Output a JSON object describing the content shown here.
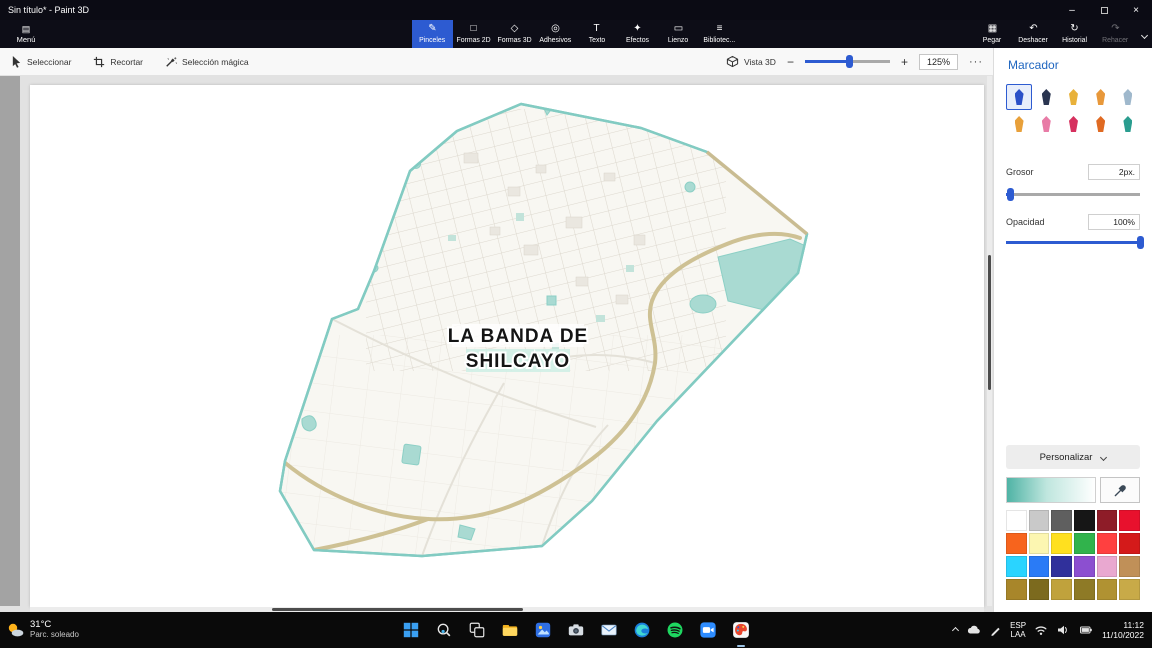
{
  "title_bar": {
    "title": "Sin título* - Paint 3D"
  },
  "icons": {
    "menu": "▤",
    "brush": "✎",
    "shapes_2d": "□",
    "shapes_3d": "◇",
    "stickers": "◎",
    "text": "T",
    "effects": "✦",
    "canvas": "▭",
    "library": "≡",
    "paste": "▦",
    "undo": "↶",
    "history": "↻",
    "redo": "↷",
    "minimize": "–",
    "close": "×",
    "more": "···",
    "left_pan": "‹",
    "minus": "−",
    "plus": "+"
  },
  "top_toolbar": {
    "menu_label": "Menú",
    "tabs": [
      {
        "label": "Pinceles",
        "active": true
      },
      {
        "label": "Formas 2D"
      },
      {
        "label": "Formas 3D"
      },
      {
        "label": "Adhesivos"
      },
      {
        "label": "Texto"
      },
      {
        "label": "Efectos"
      },
      {
        "label": "Lienzo"
      },
      {
        "label": "Bibliotec..."
      }
    ],
    "actions": [
      {
        "label": "Pegar"
      },
      {
        "label": "Deshacer"
      },
      {
        "label": "Historial"
      },
      {
        "label": "Rehacer",
        "disabled": true
      }
    ]
  },
  "sub_toolbar": {
    "select_label": "Seleccionar",
    "crop_label": "Recortar",
    "magic_label": "Selección mágica",
    "vista3d_label": "Vista 3D",
    "zoom_value": "125%"
  },
  "canvas": {
    "map_label_line1": "LA BANDA DE",
    "map_label_line2": "SHILCAYO"
  },
  "right_panel": {
    "title": "Marcador",
    "brushes": [
      {
        "name": "marker",
        "color": "#2b50c8",
        "selected": true
      },
      {
        "name": "calligraphy-pen",
        "color": "#2a3550"
      },
      {
        "name": "oil-brush",
        "color": "#e8b13a"
      },
      {
        "name": "watercolor",
        "color": "#e8983a"
      },
      {
        "name": "pixel-pen",
        "color": "#9fb8cc"
      },
      {
        "name": "pencil",
        "color": "#e8a03a"
      },
      {
        "name": "eraser",
        "color": "#e87ba6"
      },
      {
        "name": "crayon",
        "color": "#d6305e"
      },
      {
        "name": "spray-can",
        "color": "#e06a22"
      },
      {
        "name": "fill",
        "color": "#2a9d8f"
      }
    ],
    "grosor_label": "Grosor",
    "grosor_value": "2px.",
    "opacidad_label": "Opacidad",
    "opacidad_value": "100%",
    "personalizar_label": "Personalizar",
    "gradient": "linear-gradient(90deg,#4fb3a5 0%,#bfe6de 45%,#ffffff 100%)",
    "palette": [
      "#ffffff",
      "#c9c9c9",
      "#5f5f5f",
      "#161616",
      "#8e1c28",
      "#e8112d",
      "#f7641d",
      "#fcf6b1",
      "#ffe01f",
      "#31b34c",
      "#ff4040",
      "#d41a1a",
      "#2ad4ff",
      "#2a7bf6",
      "#30309b",
      "#8c4fd0",
      "#e9a8d0",
      "#c09058",
      "#a8862a",
      "#7c6a1e",
      "#c0a23c",
      "#8e7a26",
      "#b09232",
      "#c8aa48"
    ]
  },
  "taskbar": {
    "weather_temp": "31°C",
    "weather_desc": "Parc. soleado",
    "apps": [
      "start",
      "search",
      "task-view",
      "file-explorer",
      "photos",
      "camera",
      "mail",
      "edge",
      "spotify",
      "zoom",
      "paint-3d"
    ],
    "active_app": "paint-3d",
    "lang_top": "ESP",
    "lang_bottom": "LAA",
    "time": "11:12",
    "date": "11/10/2022"
  },
  "colors": {
    "accent": "#2d5bd1",
    "panel_title": "#1f66c0",
    "map_outline": "#82cbc2",
    "map_water": "#a9dad2",
    "map_road": "#cec194",
    "titlebar_bg": "#0b0b14",
    "taskbar_bg": "#0a0a0a"
  }
}
